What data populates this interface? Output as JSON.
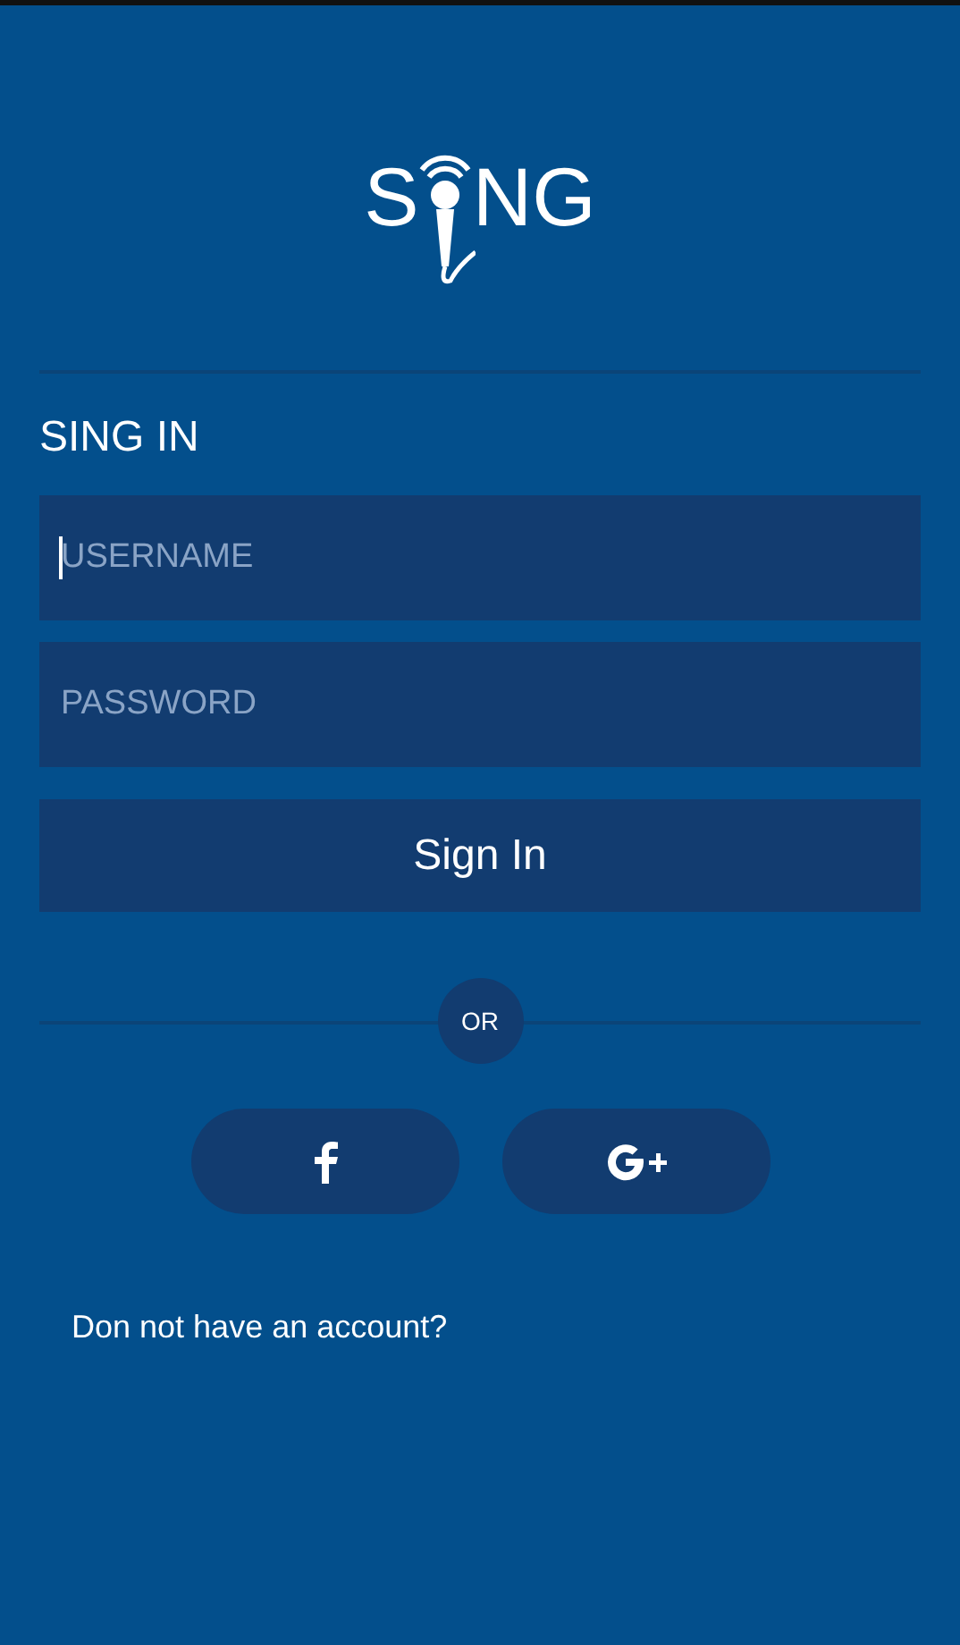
{
  "logo": {
    "left": "S",
    "right": "NG"
  },
  "heading": "SING IN",
  "fields": [
    {
      "placeholder": "USERNAME",
      "focused": true
    },
    {
      "placeholder": "PASSWORD",
      "focused": false
    }
  ],
  "submit_button": "Sign In",
  "divider_label": "OR",
  "social_buttons": [
    {
      "kind": "facebook"
    },
    {
      "kind": "google"
    }
  ],
  "signup_link": "Don not have an account?"
}
